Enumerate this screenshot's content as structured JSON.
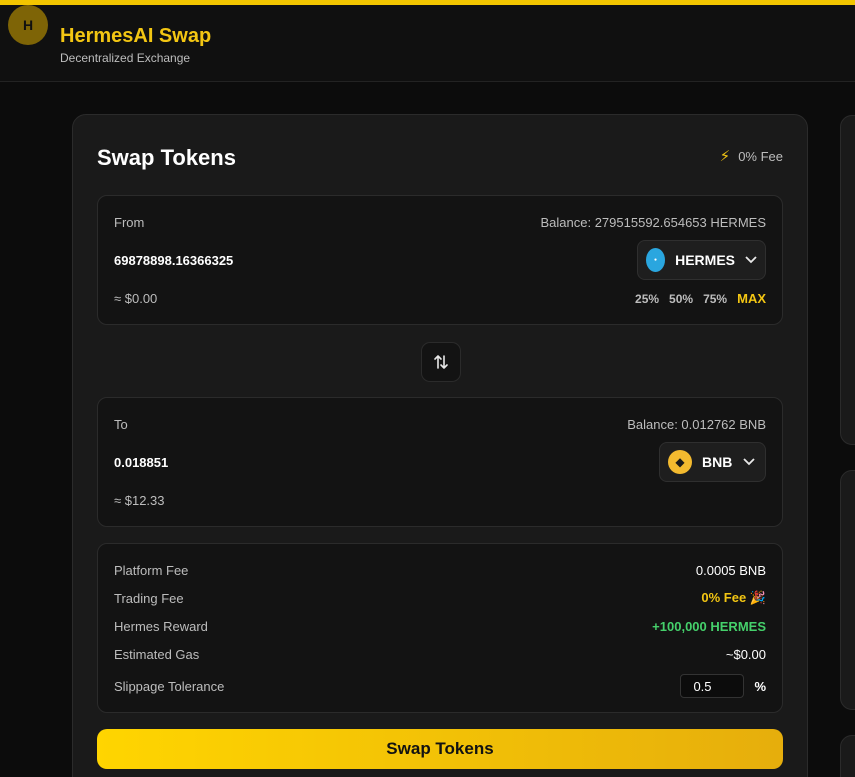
{
  "colors": {
    "accent": "#f3c613",
    "success": "#45d06b",
    "background": "#0c0c0c",
    "card": "#1a1a1a"
  },
  "header": {
    "title": "HermesAI Swap",
    "subtitle": "Decentralized Exchange",
    "logo_letter": "H"
  },
  "swap": {
    "title": "Swap Tokens",
    "fee_badge": "0% Fee",
    "from": {
      "label": "From",
      "balance": "Balance: 279515592.654653 HERMES",
      "amount": "69878898.16366325",
      "usd": "≈ $0.00",
      "token": "HERMES",
      "token_icon": "hermes-token-icon",
      "percents": [
        "25%",
        "50%",
        "75%"
      ],
      "max": "MAX"
    },
    "to": {
      "label": "To",
      "balance": "Balance: 0.012762 BNB",
      "amount": "0.018851",
      "usd": "≈ $12.33",
      "token": "BNB",
      "token_icon": "bnb-token-icon"
    },
    "fees": {
      "platform_fee_label": "Platform Fee",
      "platform_fee_value": "0.0005 BNB",
      "trading_fee_label": "Trading Fee",
      "trading_fee_value": "0% Fee 🎉",
      "reward_label": "Hermes Reward",
      "reward_value": "+100,000 HERMES",
      "gas_label": "Estimated Gas",
      "gas_value": "~$0.00",
      "slippage_label": "Slippage Tolerance",
      "slippage_value": "0.5",
      "slippage_unit": "%"
    },
    "button": "Swap Tokens"
  }
}
